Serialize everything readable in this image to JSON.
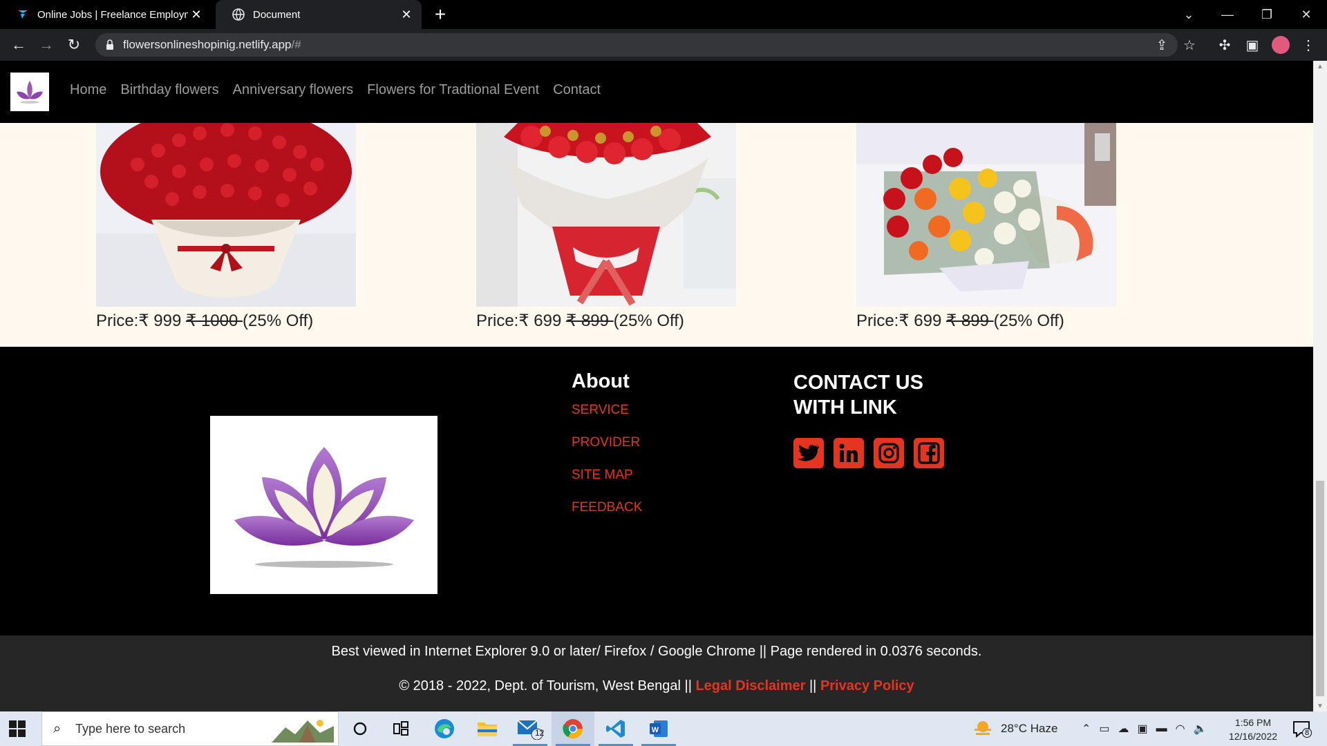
{
  "browser": {
    "tabs": [
      {
        "title": "Online Jobs | Freelance Employm",
        "active": false
      },
      {
        "title": "Document",
        "active": true
      }
    ],
    "url_main": "flowersonlineshopinig.netlify.app",
    "url_suffix": "/#"
  },
  "site": {
    "nav_links": [
      "Home",
      "Birthday flowers",
      "Anniversary flowers",
      "Flowers for Tradtional Event",
      "Contact"
    ],
    "products": [
      {
        "price_label": "Price:₹ 999 ",
        "old_price": "₹ 1000 ",
        "discount": "(25% Off)",
        "image": "red-roses-bouquet"
      },
      {
        "price_label": "Price:₹ 699 ",
        "old_price": "₹ 899 ",
        "discount": "(25% Off)",
        "image": "roses-chocolates-bouquet"
      },
      {
        "price_label": "Price:₹ 699 ",
        "old_price": "₹ 899 ",
        "discount": "(25% Off)",
        "image": "mixed-roses-bouquet"
      }
    ],
    "footer": {
      "about_title": "About",
      "about_links": [
        "SERVICE",
        "PROVIDER",
        "SITE MAP",
        "FEEDBACK"
      ],
      "contact_title_line1": "CONTACT US",
      "contact_title_line2": "WITH LINK",
      "social": [
        "twitter-icon",
        "linkedin-icon",
        "instagram-icon",
        "facebook-icon"
      ],
      "line1": "Best viewed in Internet Explorer 9.0 or later/ Firefox / Google Chrome || Page rendered in 0.0376 seconds.",
      "line2_prefix": "© 2018 - 2022, Dept. of Tourism, West Bengal || ",
      "legal": "Legal Disclaimer",
      "sep": " || ",
      "privacy": "Privacy Policy"
    }
  },
  "taskbar": {
    "search_placeholder": "Type here to search",
    "mail_badge": "12",
    "weather": "28°C  Haze",
    "time": "1:56 PM",
    "date": "12/16/2022",
    "notif_count": "8"
  },
  "colors": {
    "accent_red": "#e53520",
    "nav_link": "#9d9d9d",
    "product_bg": "#fff9ef"
  }
}
